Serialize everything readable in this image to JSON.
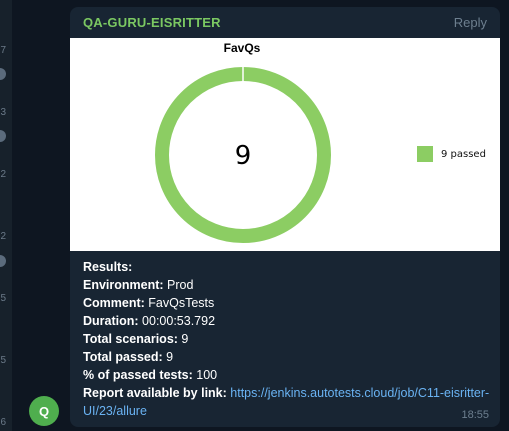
{
  "sidebar": {
    "numbers": [
      "7",
      "3",
      "2",
      "2",
      "5",
      "5",
      "6"
    ]
  },
  "avatar": {
    "letter": "Q",
    "color": "#4fae4e"
  },
  "message": {
    "sender": "QA-GURU-EISRITTER",
    "reply_label": "Reply",
    "time": "18:55",
    "lines": [
      {
        "label": "Results:",
        "value": ""
      },
      {
        "label": "Environment:",
        "value": "Prod"
      },
      {
        "label": "Comment:",
        "value": "FavQsTests"
      },
      {
        "label": "Duration:",
        "value": "00:00:53.792"
      },
      {
        "label": "Total scenarios:",
        "value": "9"
      },
      {
        "label": "Total passed:",
        "value": "9"
      },
      {
        "label": "% of passed tests:",
        "value": "100"
      }
    ],
    "report_label": "Report available by link:",
    "report_link": "https://jenkins.autotests.cloud/job/C11-eisritter-UI/23/allure"
  },
  "chart_data": {
    "type": "pie",
    "title": "FavQs",
    "center_text": "9",
    "slices": [
      {
        "label": "9 passed",
        "value": 9,
        "color": "#8ccd63"
      }
    ],
    "legend": "right"
  },
  "colors": {
    "background": "#0e1621",
    "bubble": "#182533",
    "sender": "#7bc862",
    "link": "#6ab3f3",
    "passed": "#8ccd63"
  }
}
